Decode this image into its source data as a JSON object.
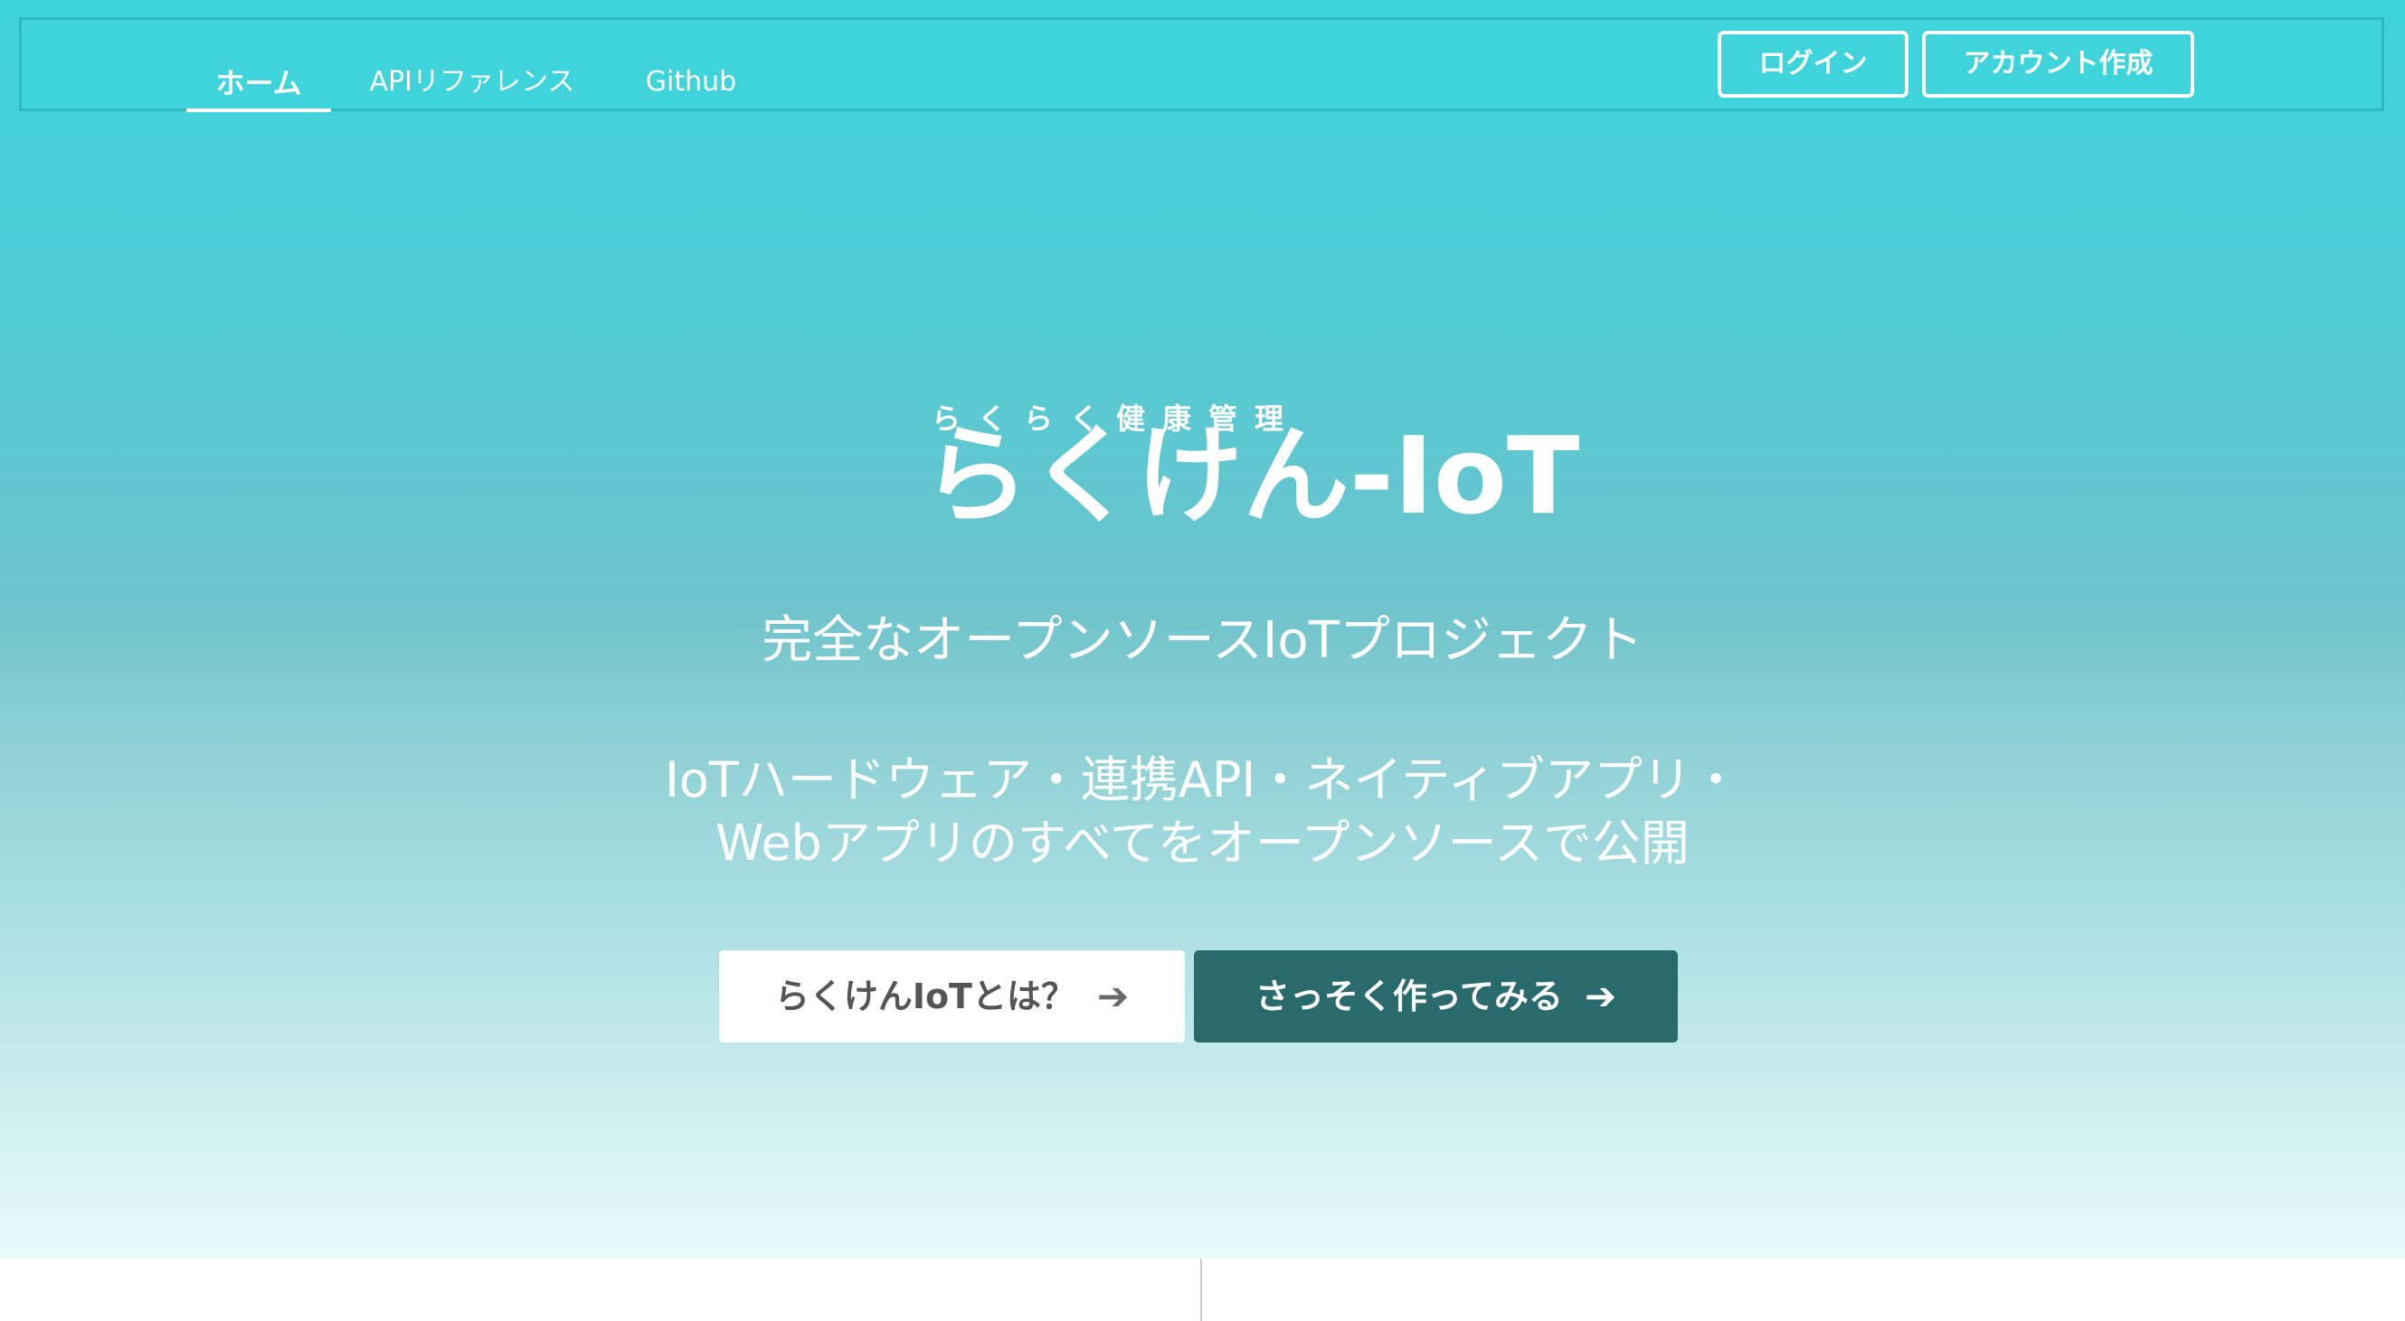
{
  "nav": {
    "links": [
      "ホーム",
      "APIリファレンス",
      "Github"
    ],
    "login_label": "ログイン",
    "signup_label": "アカウント作成"
  },
  "hero": {
    "logo_subtitle": "らくらく健康管理",
    "logo_title": "らくけん-IoT",
    "tagline": "完全なオープンソースIoTプロジェクト",
    "description_lines": [
      "IoTハードウェア・連携API・ネイティブアプリ・",
      "Webアプリのすべてをオープンソースで公開"
    ],
    "about_button_label": "らくけんIoTとは？",
    "start_button_label": "さっそく作ってみる"
  },
  "icons": {
    "about_button_icon": "arrow-right-icon",
    "start_button_icon": "arrow-right-icon"
  },
  "colors": {
    "hero_top": "#3fd3dc",
    "hero_bottom": "#e8fbfd",
    "start_button_bg": "#296a6d",
    "about_button_bg": "#ffffff"
  }
}
